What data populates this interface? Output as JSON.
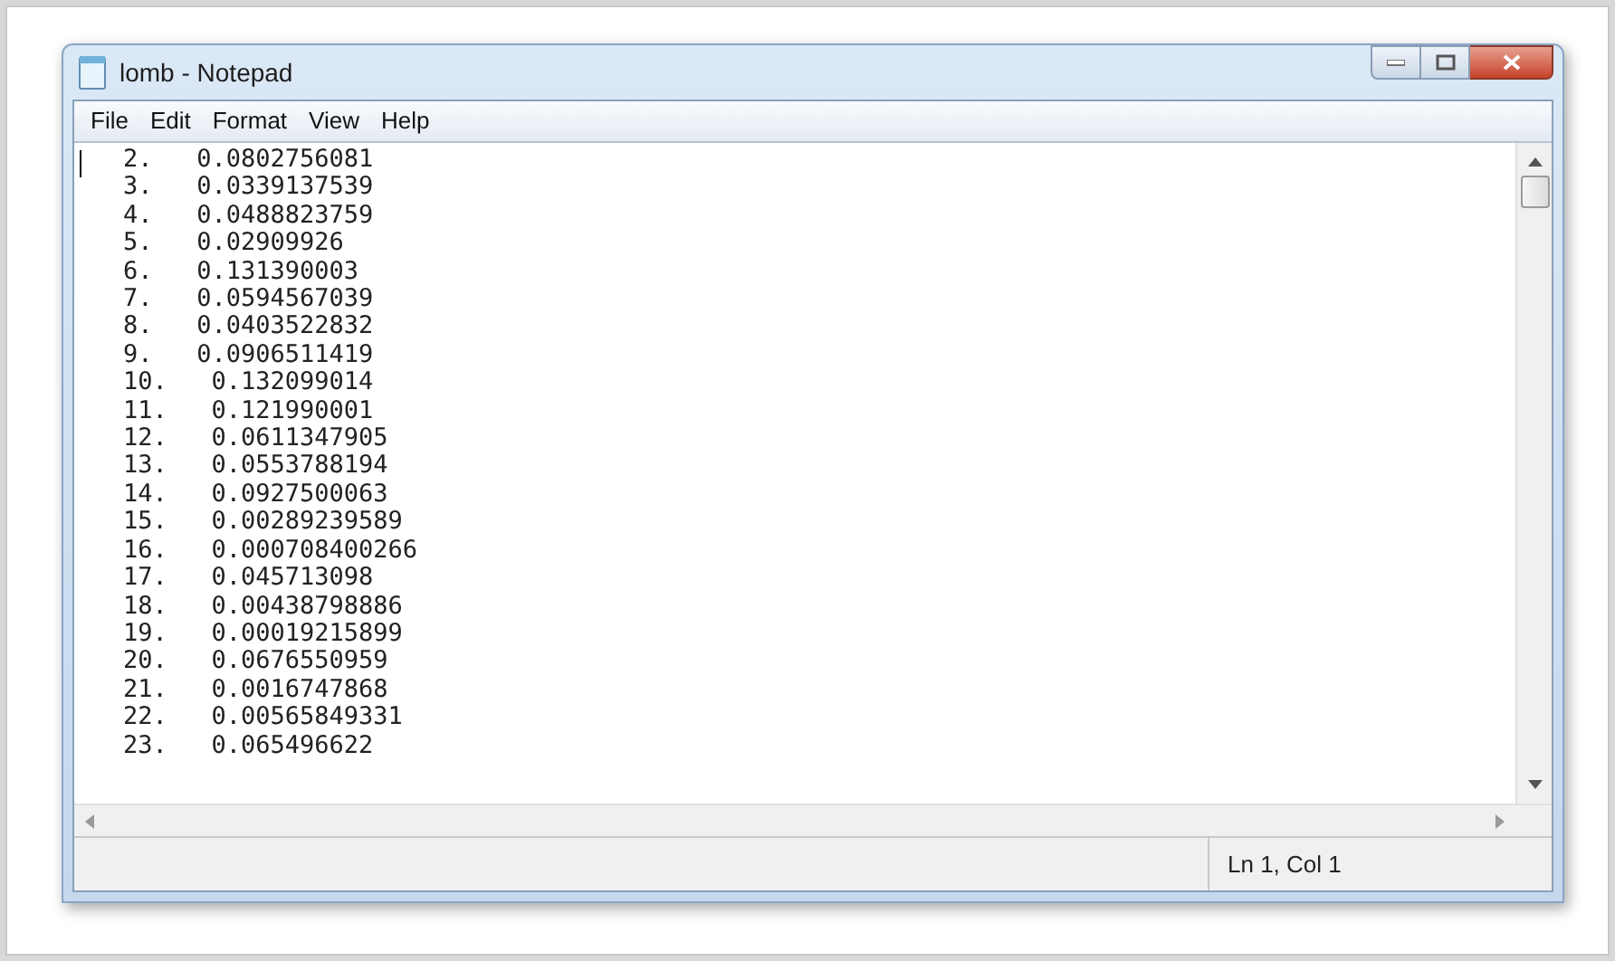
{
  "window": {
    "title": "lomb - Notepad"
  },
  "menu": [
    {
      "label": "File"
    },
    {
      "label": "Edit"
    },
    {
      "label": "Format"
    },
    {
      "label": "View"
    },
    {
      "label": "Help"
    }
  ],
  "lines": [
    "2.   0.0802756081",
    "3.   0.0339137539",
    "4.   0.0488823759",
    "5.   0.02909926",
    "6.   0.131390003",
    "7.   0.0594567039",
    "8.   0.0403522832",
    "9.   0.0906511419",
    "10.   0.132099014",
    "11.   0.121990001",
    "12.   0.0611347905",
    "13.   0.0553788194",
    "14.   0.0927500063",
    "15.   0.00289239589",
    "16.   0.000708400266",
    "17.   0.045713098",
    "18.   0.00438798886",
    "19.   0.00019215899",
    "20.   0.0676550959",
    "21.   0.0016747868",
    "22.   0.00565849331",
    "23.   0.065496622"
  ],
  "status_bar": {
    "position": "Ln 1, Col 1"
  }
}
